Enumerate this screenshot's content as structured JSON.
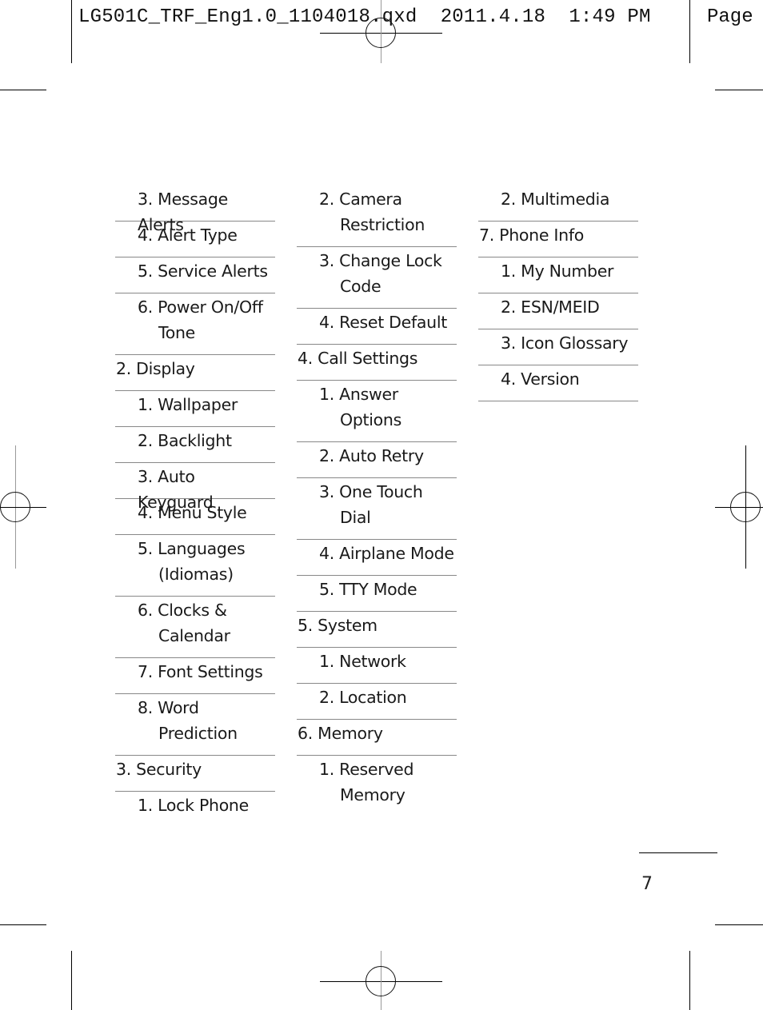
{
  "slug": {
    "filename": "LG501C_TRF_Eng1.0_1104018.qxd",
    "date": "2011.4.18",
    "time": "1:49 PM",
    "page_label": "Page"
  },
  "columns": [
    {
      "items": [
        {
          "level": 1,
          "lines": [
            "3. Message Alerts"
          ]
        },
        {
          "level": 1,
          "lines": [
            "4. Alert Type"
          ]
        },
        {
          "level": 1,
          "lines": [
            "5. Service Alerts"
          ]
        },
        {
          "level": 1,
          "lines": [
            "6. Power On/Off",
            "Tone"
          ]
        },
        {
          "level": 0,
          "lines": [
            "2. Display"
          ]
        },
        {
          "level": 1,
          "lines": [
            "1. Wallpaper"
          ]
        },
        {
          "level": 1,
          "lines": [
            "2. Backlight"
          ]
        },
        {
          "level": 1,
          "lines": [
            "3. Auto Keyguard"
          ]
        },
        {
          "level": 1,
          "lines": [
            "4. Menu Style"
          ]
        },
        {
          "level": 1,
          "lines": [
            "5. Languages",
            "(Idiomas)"
          ]
        },
        {
          "level": 1,
          "lines": [
            "6. Clocks &",
            "Calendar"
          ]
        },
        {
          "level": 1,
          "lines": [
            "7.  Font Settings"
          ]
        },
        {
          "level": 1,
          "lines": [
            "8. Word",
            "Prediction"
          ]
        },
        {
          "level": 0,
          "lines": [
            "3. Security"
          ]
        },
        {
          "level": 1,
          "lines": [
            "1. Lock Phone"
          ],
          "last": true
        }
      ]
    },
    {
      "items": [
        {
          "level": 1,
          "lines": [
            "2. Camera",
            "Restriction"
          ]
        },
        {
          "level": 1,
          "lines": [
            "3. Change Lock",
            "Code"
          ]
        },
        {
          "level": 1,
          "lines": [
            "4. Reset Default"
          ]
        },
        {
          "level": 0,
          "lines": [
            "4. Call Settings"
          ]
        },
        {
          "level": 1,
          "lines": [
            "1. Answer",
            "Options"
          ]
        },
        {
          "level": 1,
          "lines": [
            "2. Auto Retry"
          ]
        },
        {
          "level": 1,
          "lines": [
            "3. One Touch",
            "Dial"
          ]
        },
        {
          "level": 1,
          "lines": [
            "4. Airplane Mode"
          ]
        },
        {
          "level": 1,
          "lines": [
            "5. TTY Mode"
          ]
        },
        {
          "level": 0,
          "lines": [
            "5. System"
          ]
        },
        {
          "level": 1,
          "lines": [
            "1. Network"
          ]
        },
        {
          "level": 1,
          "lines": [
            "2. Location"
          ]
        },
        {
          "level": 0,
          "lines": [
            "6. Memory"
          ]
        },
        {
          "level": 1,
          "lines": [
            "1. Reserved",
            "Memory"
          ],
          "last": true
        }
      ]
    },
    {
      "items": [
        {
          "level": 1,
          "lines": [
            "2. Multimedia"
          ]
        },
        {
          "level": 0,
          "lines": [
            "7.  Phone Info"
          ]
        },
        {
          "level": 1,
          "lines": [
            "1. My Number"
          ]
        },
        {
          "level": 1,
          "lines": [
            "2. ESN/MEID"
          ]
        },
        {
          "level": 1,
          "lines": [
            "3. Icon Glossary"
          ]
        },
        {
          "level": 1,
          "lines": [
            "4. Version"
          ]
        }
      ]
    }
  ],
  "page_number": "7"
}
